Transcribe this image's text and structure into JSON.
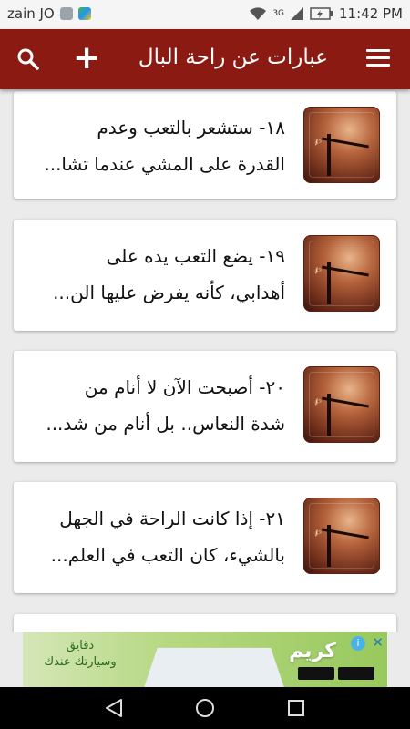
{
  "status_bar": {
    "carrier": "zain JO",
    "network": "3G",
    "time": "11:42 PM"
  },
  "app_bar": {
    "title": "عبارات عن راحة البال",
    "icons": [
      "menu-icon",
      "plus-icon",
      "search-icon"
    ]
  },
  "cards": [
    {
      "line1": "١٨- ستشعر بالتعب وعدم",
      "line2": "القدرة على المشي عندما تشا..."
    },
    {
      "line1": "١٩- يضع التعب يده على",
      "line2": "أهدابي، كأنه يفرض عليها الن..."
    },
    {
      "line1": "٢٠- أصبحت الآن لا أنام من",
      "line2": "شدة النعاس.. بل أنام من شد..."
    },
    {
      "line1": "٢١- إذا كانت الراحة في الجهل",
      "line2": "بالشيء، كان التعب في العلم..."
    }
  ],
  "ad": {
    "brand": "كريم",
    "tagline1": "دقايق",
    "tagline2": "وسيارتك عندك"
  },
  "colors": {
    "app_bar": "#8b1a12",
    "background": "#ebebeb"
  }
}
